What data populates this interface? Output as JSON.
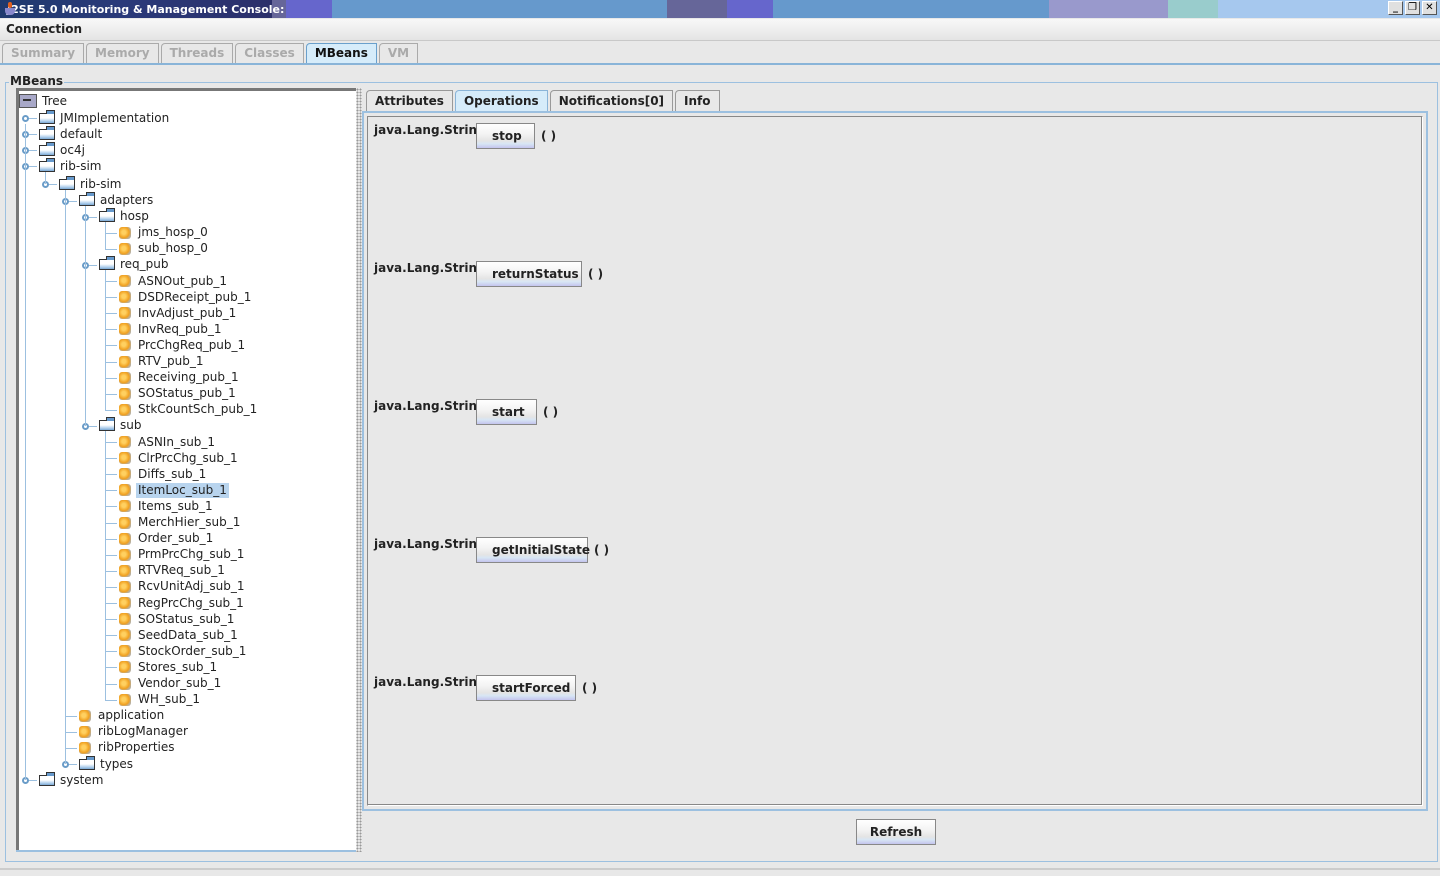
{
  "window": {
    "title": "J2SE 5.0 Monitoring & Management Console:",
    "controls": [
      "minimize",
      "restore",
      "close"
    ]
  },
  "menubar": {
    "connection_label": "Connection"
  },
  "main_tabs": [
    {
      "label": "Summary",
      "active": false
    },
    {
      "label": "Memory",
      "active": false
    },
    {
      "label": "Threads",
      "active": false
    },
    {
      "label": "Classes",
      "active": false
    },
    {
      "label": "MBeans",
      "active": true
    },
    {
      "label": "VM",
      "active": false
    }
  ],
  "mbeans_group_label": "MBeans",
  "tree": {
    "root_label": "Tree",
    "nodes": [
      {
        "label": "JMImplementation",
        "type": "folder",
        "depth": 0,
        "expander": true
      },
      {
        "label": "default",
        "type": "folder",
        "depth": 0,
        "expander": true
      },
      {
        "label": "oc4j",
        "type": "folder",
        "depth": 0,
        "expander": true
      },
      {
        "label": "rib-sim",
        "type": "folder",
        "depth": 0,
        "expander": true,
        "expanded": true
      },
      {
        "label": "rib-sim",
        "type": "folder",
        "depth": 1,
        "expander": true,
        "expanded": true
      },
      {
        "label": "adapters",
        "type": "folder",
        "depth": 2,
        "expander": true,
        "expanded": true
      },
      {
        "label": "hosp",
        "type": "folder",
        "depth": 3,
        "expander": true,
        "expanded": true
      },
      {
        "label": "jms_hosp_0",
        "type": "bean",
        "depth": 4
      },
      {
        "label": "sub_hosp_0",
        "type": "bean",
        "depth": 4
      },
      {
        "label": "req_pub",
        "type": "folder",
        "depth": 3,
        "expander": true,
        "expanded": true
      },
      {
        "label": "ASNOut_pub_1",
        "type": "bean",
        "depth": 4
      },
      {
        "label": "DSDReceipt_pub_1",
        "type": "bean",
        "depth": 4
      },
      {
        "label": "InvAdjust_pub_1",
        "type": "bean",
        "depth": 4
      },
      {
        "label": "InvReq_pub_1",
        "type": "bean",
        "depth": 4
      },
      {
        "label": "PrcChgReq_pub_1",
        "type": "bean",
        "depth": 4
      },
      {
        "label": "RTV_pub_1",
        "type": "bean",
        "depth": 4
      },
      {
        "label": "Receiving_pub_1",
        "type": "bean",
        "depth": 4
      },
      {
        "label": "SOStatus_pub_1",
        "type": "bean",
        "depth": 4
      },
      {
        "label": "StkCountSch_pub_1",
        "type": "bean",
        "depth": 4
      },
      {
        "label": "sub",
        "type": "folder",
        "depth": 3,
        "expander": true,
        "expanded": true
      },
      {
        "label": "ASNIn_sub_1",
        "type": "bean",
        "depth": 4
      },
      {
        "label": "ClrPrcChg_sub_1",
        "type": "bean",
        "depth": 4
      },
      {
        "label": "Diffs_sub_1",
        "type": "bean",
        "depth": 4
      },
      {
        "label": "ItemLoc_sub_1",
        "type": "bean",
        "depth": 4,
        "selected": true
      },
      {
        "label": "Items_sub_1",
        "type": "bean",
        "depth": 4
      },
      {
        "label": "MerchHier_sub_1",
        "type": "bean",
        "depth": 4
      },
      {
        "label": "Order_sub_1",
        "type": "bean",
        "depth": 4
      },
      {
        "label": "PrmPrcChg_sub_1",
        "type": "bean",
        "depth": 4
      },
      {
        "label": "RTVReq_sub_1",
        "type": "bean",
        "depth": 4
      },
      {
        "label": "RcvUnitAdj_sub_1",
        "type": "bean",
        "depth": 4
      },
      {
        "label": "RegPrcChg_sub_1",
        "type": "bean",
        "depth": 4
      },
      {
        "label": "SOStatus_sub_1",
        "type": "bean",
        "depth": 4
      },
      {
        "label": "SeedData_sub_1",
        "type": "bean",
        "depth": 4
      },
      {
        "label": "StockOrder_sub_1",
        "type": "bean",
        "depth": 4
      },
      {
        "label": "Stores_sub_1",
        "type": "bean",
        "depth": 4
      },
      {
        "label": "Vendor_sub_1",
        "type": "bean",
        "depth": 4
      },
      {
        "label": "WH_sub_1",
        "type": "bean",
        "depth": 4
      },
      {
        "label": "application",
        "type": "bean",
        "depth": 2
      },
      {
        "label": "ribLogManager",
        "type": "bean",
        "depth": 2
      },
      {
        "label": "ribProperties",
        "type": "bean",
        "depth": 2
      },
      {
        "label": "types",
        "type": "folder",
        "depth": 2,
        "expander": true
      },
      {
        "label": "system",
        "type": "folder",
        "depth": 0,
        "expander": true
      }
    ]
  },
  "detail_tabs": [
    {
      "label": "Attributes",
      "active": false
    },
    {
      "label": "Operations",
      "active": true
    },
    {
      "label": "Notifications[0]",
      "active": false
    },
    {
      "label": "Info",
      "active": false
    }
  ],
  "operations": [
    {
      "return_type": "java.Lang.String",
      "name": "stop",
      "params": "( )"
    },
    {
      "return_type": "java.Lang.String",
      "name": "returnStatus",
      "params": "( )"
    },
    {
      "return_type": "java.Lang.String",
      "name": "start",
      "params": "( )"
    },
    {
      "return_type": "java.Lang.String",
      "name": "getInitialState",
      "params": "( )"
    },
    {
      "return_type": "java.Lang.String",
      "name": "startForced",
      "params": "( )"
    }
  ],
  "refresh_label": "Refresh",
  "colors": {
    "title_bar": "#6699cc",
    "active_tab": "#d6ecfa",
    "selection": "#b8d4ee",
    "tree_lines": "#9cc0e0"
  }
}
